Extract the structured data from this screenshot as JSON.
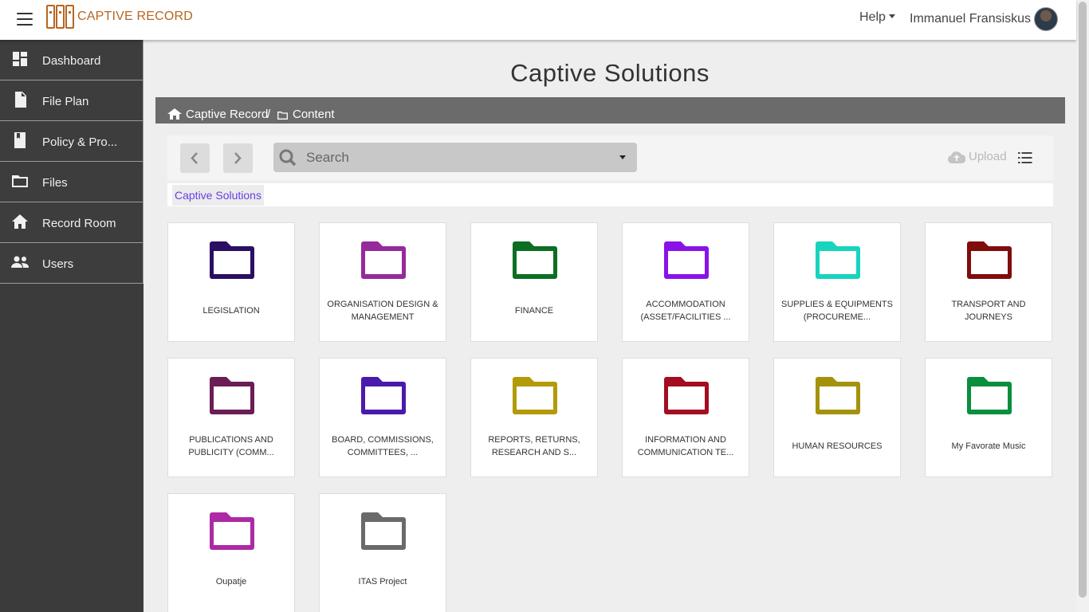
{
  "app": {
    "title": "CAPTIVE RECORD",
    "help_label": "Help",
    "user_name": "Immanuel Fransiskus"
  },
  "sidebar": {
    "items": [
      {
        "label": "Dashboard",
        "icon": "dashboard-icon"
      },
      {
        "label": "File Plan",
        "icon": "file-icon"
      },
      {
        "label": "Policy & Pro...",
        "icon": "book-icon"
      },
      {
        "label": "Files",
        "icon": "folder-icon"
      },
      {
        "label": "Record Room",
        "icon": "home-icon"
      },
      {
        "label": "Users",
        "icon": "users-icon"
      }
    ]
  },
  "page": {
    "title": "Captive Solutions"
  },
  "breadcrumb": {
    "root": "Captive Record",
    "separator": "/",
    "current": "Content"
  },
  "toolbar": {
    "search_placeholder": "Search",
    "upload_label": "Upload"
  },
  "path_chip": "Captive Solutions",
  "folders": [
    {
      "name": "LEGISLATION",
      "color": "#2a0f63"
    },
    {
      "name": "ORGANISATION DESIGN & MANAGEMENT",
      "color": "#962a9b"
    },
    {
      "name": "FINANCE",
      "color": "#0b6e22"
    },
    {
      "name": "ACCOMMODATION (ASSET/FACILITIES ...",
      "color": "#8a12e8"
    },
    {
      "name": "SUPPLIES & EQUIPMENTS (PROCUREME...",
      "color": "#17d4bd"
    },
    {
      "name": "TRANSPORT AND JOURNEYS",
      "color": "#800c0c"
    },
    {
      "name": "PUBLICATIONS AND PUBLICITY (COMM...",
      "color": "#6b1d55"
    },
    {
      "name": "BOARD, COMMISSIONS, COMMITTEES, ...",
      "color": "#4a1aac"
    },
    {
      "name": "REPORTS, RETURNS, RESEARCH AND S...",
      "color": "#b39a09"
    },
    {
      "name": "INFORMATION AND COMMUNICATION TE...",
      "color": "#a40d20"
    },
    {
      "name": "HUMAN RESOURCES",
      "color": "#a4920f"
    },
    {
      "name": "My Favorate Music",
      "color": "#0a8f3c"
    },
    {
      "name": "Oupatje",
      "color": "#ac2aa6"
    },
    {
      "name": "ITAS Project",
      "color": "#6a6a6a"
    }
  ]
}
